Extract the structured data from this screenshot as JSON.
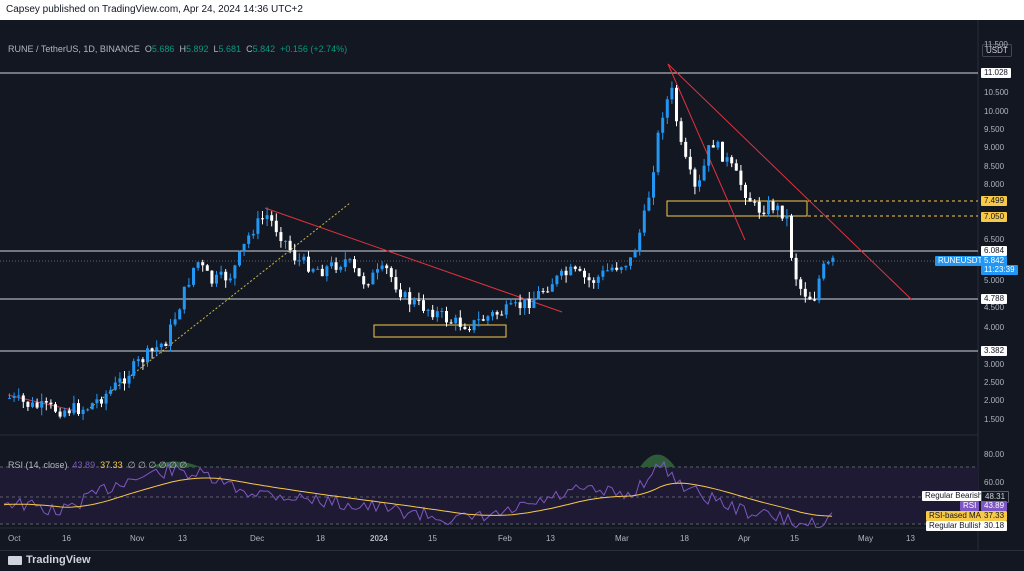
{
  "header": {
    "published_text": "Capsey published on TradingView.com, Apr 24, 2024 14:36 UTC+2"
  },
  "legend": {
    "symbol": "RUNE / TetherUS, 1D, BINANCE",
    "open_label": "O",
    "open_value": "5.686",
    "high_label": "H",
    "high_value": "5.892",
    "low_label": "L",
    "low_value": "5.681",
    "close_label": "C",
    "close_value": "5.842",
    "change": "+0.156 (+2.74%)"
  },
  "currency_label": "USDT",
  "price_axis": {
    "ticks": [
      "11.500",
      "11.028",
      "10.500",
      "10.000",
      "9.500",
      "9.000",
      "8.500",
      "8.000",
      "7.499",
      "7.050",
      "6.500",
      "6.084",
      "5.842",
      "5.500",
      "5.000",
      "4.788",
      "4.500",
      "4.000",
      "3.382",
      "3.000",
      "2.500",
      "2.000",
      "1.500"
    ]
  },
  "price_tags": {
    "resistance_top": "11.028",
    "dash_upper": "7.499",
    "dash_lower": "7.050",
    "level_6084": "6.084",
    "symbol_tag": "RUNEUSDT",
    "current_price": "5.842",
    "countdown": "11:23:39",
    "support_4788": "4.788",
    "support_3382": "3.382"
  },
  "time_axis": {
    "labels": [
      "Oct",
      "16",
      "Nov",
      "13",
      "Dec",
      "18",
      "2024",
      "15",
      "Feb",
      "13",
      "Mar",
      "18",
      "Apr",
      "15",
      "May",
      "13"
    ]
  },
  "rsi": {
    "title": "RSI (14, close)",
    "rsi_value": "43.89",
    "ma_value": "37.33",
    "placeholders": "∅ ∅ ∅ ∅ ∅ ∅",
    "axis_ticks": [
      "80.00",
      "60.00",
      "48.31",
      "43.89",
      "37.33",
      "30.18"
    ],
    "tags": {
      "regular_bearish_label": "Regular Bearish",
      "regular_bearish_value": "48.31",
      "rsi_label": "RSI",
      "rsi_value": "43.89",
      "ma_label": "RSI-based MA",
      "ma_value": "37.33",
      "regular_bullish_label": "Regular Bullish",
      "regular_bullish_value": "30.18"
    }
  },
  "footer": {
    "brand": "TradingView"
  },
  "colors": {
    "background": "#131722",
    "up": "#2196f3",
    "down": "#ffffff",
    "trendline": "#e0323d",
    "box": "#f7c948",
    "rsi": "#7e57c2",
    "rsi_ma": "#f7c948"
  },
  "chart_data": {
    "type": "candlestick",
    "symbol": "RUNE / TetherUS",
    "timeframe": "1D",
    "exchange": "BINANCE",
    "last_close": 5.842,
    "horizontal_levels": [
      11.028,
      7.499,
      7.05,
      6.084,
      4.788,
      3.382
    ],
    "ylim": [
      1.2,
      12.0
    ],
    "rsi": {
      "period": 14,
      "value": 43.89,
      "ma": 37.33,
      "levels": [
        80,
        70,
        48.31,
        30.18
      ]
    }
  }
}
